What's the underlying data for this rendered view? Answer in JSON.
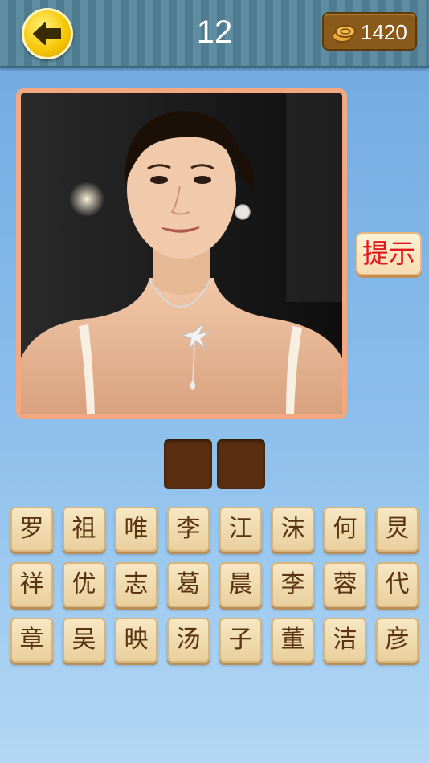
{
  "header": {
    "back_icon": "back-arrow-icon",
    "level_number": "12",
    "coin_icon": "coins-icon",
    "coin_count": "1420"
  },
  "photo": {
    "description_icon": "celebrity-photo"
  },
  "hint_button": {
    "label": "提示"
  },
  "answer_slots": [
    "",
    ""
  ],
  "letter_tiles": [
    [
      "罗",
      "祖",
      "唯",
      "李",
      "江",
      "沫",
      "何",
      "炅"
    ],
    [
      "祥",
      "优",
      "志",
      "葛",
      "晨",
      "李",
      "蓉",
      "代"
    ],
    [
      "章",
      "吴",
      "映",
      "汤",
      "子",
      "董",
      "洁",
      "彦"
    ]
  ],
  "colors": {
    "slot": "#5a2e10",
    "tile_text": "#5a3312",
    "hint_text": "#e0191c",
    "frame": "#f3a880"
  }
}
